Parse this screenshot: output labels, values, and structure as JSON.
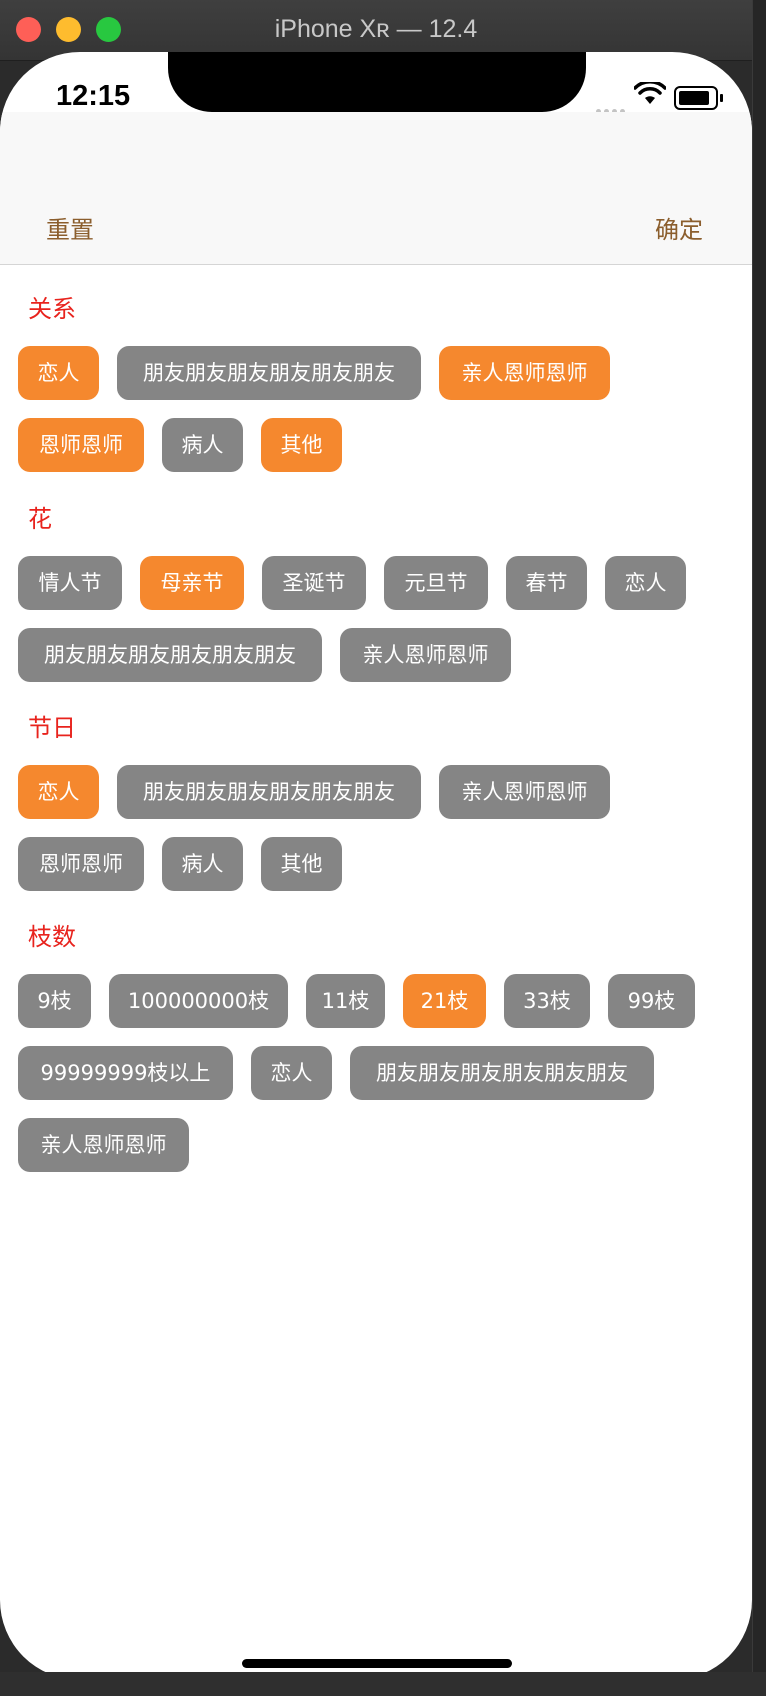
{
  "window": {
    "title": "iPhone Xʀ — 12.4"
  },
  "status_bar": {
    "time": "12:15"
  },
  "navbar": {
    "reset_label": "重置",
    "confirm_label": "确定"
  },
  "colors": {
    "selected": "#f5882e",
    "unselected": "#858585",
    "section_title": "#e8231d",
    "nav_text": "#8b5e2d"
  },
  "sections": [
    {
      "title": "关系",
      "tags": [
        {
          "label": "恋人",
          "selected": true
        },
        {
          "label": "朋友朋友朋友朋友朋友朋友",
          "selected": false
        },
        {
          "label": "亲人恩师恩师",
          "selected": true
        },
        {
          "label": "恩师恩师",
          "selected": true
        },
        {
          "label": "病人",
          "selected": false
        },
        {
          "label": "其他",
          "selected": true
        }
      ]
    },
    {
      "title": "花",
      "tags": [
        {
          "label": "情人节",
          "selected": false
        },
        {
          "label": "母亲节",
          "selected": true
        },
        {
          "label": "圣诞节",
          "selected": false
        },
        {
          "label": "元旦节",
          "selected": false
        },
        {
          "label": "春节",
          "selected": false
        },
        {
          "label": "恋人",
          "selected": false
        },
        {
          "label": "朋友朋友朋友朋友朋友朋友",
          "selected": false
        },
        {
          "label": "亲人恩师恩师",
          "selected": false
        }
      ]
    },
    {
      "title": "节日",
      "tags": [
        {
          "label": "恋人",
          "selected": true
        },
        {
          "label": "朋友朋友朋友朋友朋友朋友",
          "selected": false
        },
        {
          "label": "亲人恩师恩师",
          "selected": false
        },
        {
          "label": "恩师恩师",
          "selected": false
        },
        {
          "label": "病人",
          "selected": false
        },
        {
          "label": "其他",
          "selected": false
        }
      ]
    },
    {
      "title": "枝数",
      "tags": [
        {
          "label": "9枝",
          "selected": false
        },
        {
          "label": "100000000枝",
          "selected": false
        },
        {
          "label": "11枝",
          "selected": false
        },
        {
          "label": "21枝",
          "selected": true
        },
        {
          "label": "33枝",
          "selected": false
        },
        {
          "label": "99枝",
          "selected": false
        },
        {
          "label": "99999999枝以上",
          "selected": false
        },
        {
          "label": "恋人",
          "selected": false
        },
        {
          "label": "朋友朋友朋友朋友朋友朋友",
          "selected": false
        },
        {
          "label": "亲人恩师恩师",
          "selected": false
        }
      ]
    }
  ]
}
